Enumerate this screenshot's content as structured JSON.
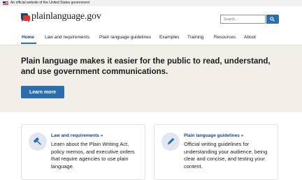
{
  "gov_banner": {
    "text": "An official website of the United States government"
  },
  "header": {
    "site_name": "plainlanguage.gov",
    "search_placeholder": "Search..."
  },
  "nav": {
    "items": [
      {
        "label": "Home"
      },
      {
        "label": "Law and requirements"
      },
      {
        "label": "Plain language guidelines"
      },
      {
        "label": "Examples"
      },
      {
        "label": "Training"
      },
      {
        "label": "Resources"
      },
      {
        "label": "About"
      }
    ]
  },
  "hero": {
    "title": "Plain language makes it easier for the public to read, understand, and use government communications.",
    "button_label": "Learn more"
  },
  "cards": [
    {
      "icon": "gavel-icon",
      "title": "Law and requirements »",
      "text": "Learn about the Plain Writing Act, policy memos, and executive orders that require agencies to use plain language."
    },
    {
      "icon": "pencil-icon",
      "title": "Plain language guidelines »",
      "text": "Official writing guidelines for understanding your audience, being clear and concise, and testing your content."
    }
  ],
  "colors": {
    "primary": "#2b6dad",
    "link": "#1a4480",
    "hero_bg": "#f2efe9",
    "logo_blue": "#1a4480",
    "logo_red": "#d83933"
  }
}
